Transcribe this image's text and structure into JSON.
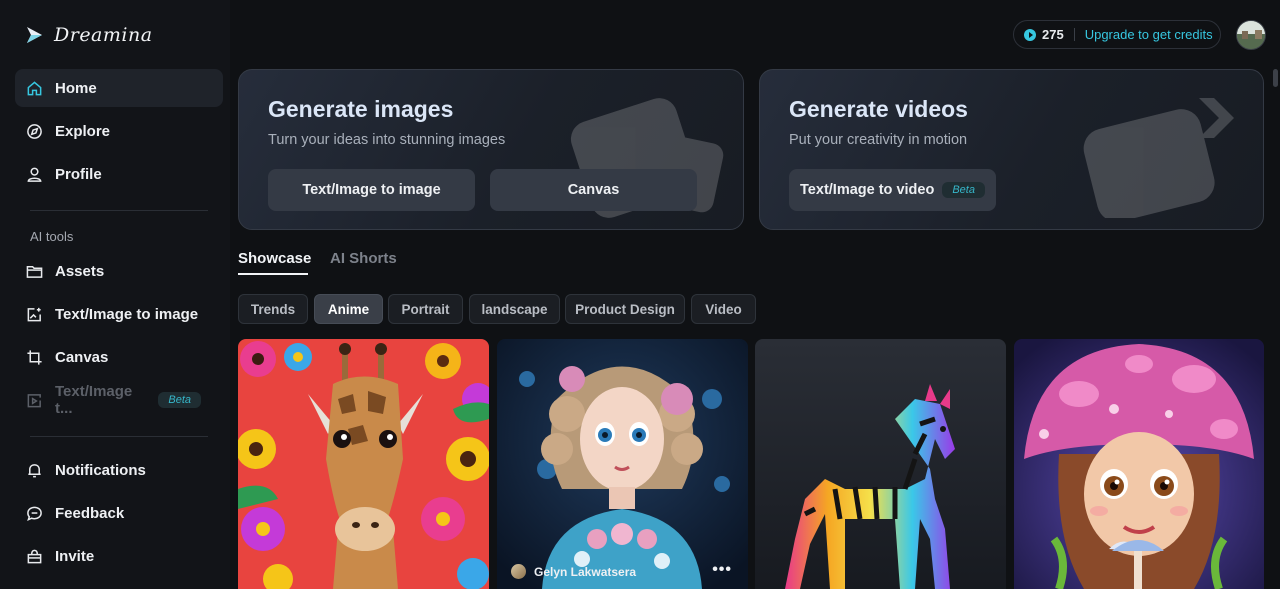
{
  "app": {
    "logo_text": "Dreamina"
  },
  "sidebar": {
    "items": [
      {
        "label": "Home",
        "icon": "home-icon",
        "active": true
      },
      {
        "label": "Explore",
        "icon": "compass-icon"
      },
      {
        "label": "Profile",
        "icon": "user-icon"
      }
    ],
    "section_label": "AI tools",
    "tools": [
      {
        "label": "Assets",
        "icon": "folder-icon"
      },
      {
        "label": "Text/Image to image",
        "icon": "image-edit-icon"
      },
      {
        "label": "Canvas",
        "icon": "crop-icon"
      },
      {
        "label": "Text/Image t...",
        "icon": "video-play-icon",
        "badge": "Beta",
        "disabled": true
      }
    ],
    "bottom": [
      {
        "label": "Notifications",
        "icon": "bell-icon"
      },
      {
        "label": "Feedback",
        "icon": "chat-icon"
      },
      {
        "label": "Invite",
        "icon": "gift-icon"
      }
    ]
  },
  "topbar": {
    "credits": "275",
    "upgrade_label": "Upgrade to get credits"
  },
  "cards": {
    "images": {
      "title": "Generate images",
      "subtitle": "Turn your ideas into stunning images",
      "buttons": [
        "Text/Image to image",
        "Canvas"
      ]
    },
    "videos": {
      "title": "Generate videos",
      "subtitle": "Put your creativity in motion",
      "button": "Text/Image to video",
      "badge": "Beta"
    }
  },
  "tabs": [
    "Showcase",
    "AI Shorts"
  ],
  "filters": [
    "Trends",
    "Anime",
    "Portrait",
    "landscape",
    "Product Design",
    "Video"
  ],
  "active_filter": "Anime",
  "gallery": {
    "author": "Gelyn Lakwatsera",
    "more": "•••"
  },
  "colors": {
    "accent": "#37c7e0",
    "background": "#0f1114",
    "sidebar_active": "#1f232a"
  }
}
